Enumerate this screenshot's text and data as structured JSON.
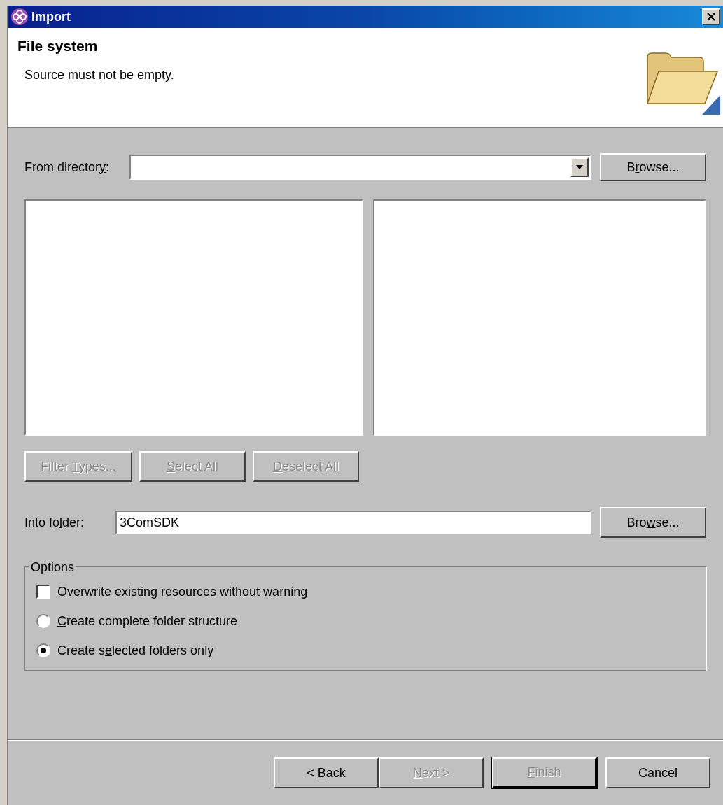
{
  "window": {
    "title": "Import"
  },
  "header": {
    "title": "File system",
    "message": "Source must not be empty."
  },
  "from_directory": {
    "label": {
      "pre": "From director",
      "key": "y",
      "post": ":"
    },
    "browse": {
      "label": {
        "pre": "B",
        "key": "r",
        "post": "owse..."
      },
      "disabled": false
    }
  },
  "selection_buttons": [
    {
      "label": {
        "pre": "Filter ",
        "key": "T",
        "post": "ypes..."
      },
      "disabled": true
    },
    {
      "label": {
        "key": "S",
        "post": "elect All"
      },
      "disabled": true
    },
    {
      "label": {
        "key": "D",
        "post": "eselect All"
      },
      "disabled": true
    }
  ],
  "into_folder": {
    "label": {
      "pre": "Into fo",
      "key": "l",
      "post": "der:"
    },
    "value": "3ComSDK",
    "browse": {
      "label": {
        "pre": "Bro",
        "key": "w",
        "post": "se..."
      },
      "disabled": false
    }
  },
  "options": {
    "title": "Options",
    "items": [
      {
        "kind": "checkbox",
        "label": {
          "key": "O",
          "post": "verwrite existing resources without warning"
        },
        "checked": false
      },
      {
        "kind": "radio",
        "label": {
          "key": "C",
          "post": "reate complete folder structure"
        },
        "selected": false
      },
      {
        "kind": "radio",
        "label": {
          "pre": "Create s",
          "key": "e",
          "post": "lected folders only"
        },
        "selected": true
      }
    ]
  },
  "buttons": [
    {
      "label": {
        "pre": "< ",
        "key": "B",
        "post": "ack"
      },
      "disabled": false,
      "default": false
    },
    {
      "label": {
        "key": "N",
        "post": "ext >"
      },
      "disabled": true,
      "default": false
    },
    {
      "label": {
        "key": "F",
        "post": "inish"
      },
      "disabled": true,
      "default": true
    },
    {
      "label": {
        "pre": "Cancel"
      },
      "disabled": false,
      "default": false
    }
  ]
}
